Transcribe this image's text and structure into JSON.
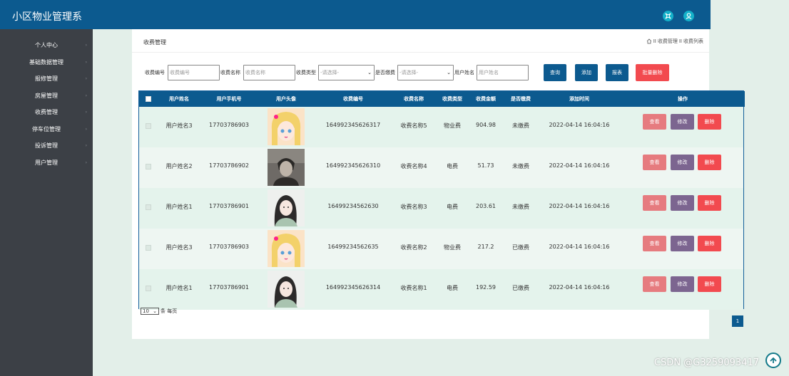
{
  "app": {
    "title": "小区物业管理系"
  },
  "header": {
    "settings_icon": "settings-icon",
    "user_icon": "user-icon"
  },
  "sidebar": {
    "items": [
      {
        "label": "个人中心"
      },
      {
        "label": "基础数据管理"
      },
      {
        "label": "报修管理"
      },
      {
        "label": "房屋管理"
      },
      {
        "label": "收费管理"
      },
      {
        "label": "停车位管理"
      },
      {
        "label": "投诉管理"
      },
      {
        "label": "用户管理"
      }
    ]
  },
  "page": {
    "title": "收费管理",
    "breadcrumb": "收费管理",
    "breadcrumb_sep": "II",
    "breadcrumb_current": "收费列表",
    "breadcrumb_home_sep": "II"
  },
  "search": {
    "fee_no_label": "收费编号",
    "fee_no_placeholder": "收费编号",
    "fee_name_label": "收费名称",
    "fee_name_placeholder": "收费名称",
    "fee_type_label": "收费类型",
    "fee_type_value": "-请选择-",
    "paid_label": "是否缴费",
    "paid_value": "-请选择-",
    "username_label": "用户姓名",
    "username_placeholder": "用户姓名"
  },
  "toolbar": {
    "query": "查询",
    "add": "添加",
    "report": "报表",
    "batch_delete": "批量删除",
    "colors": {
      "primary": "#0c5a8f",
      "danger": "#f24a4f"
    }
  },
  "table": {
    "headers": [
      "用户姓名",
      "用户手机号",
      "用户头像",
      "收费编号",
      "收费名称",
      "收费类型",
      "收费金额",
      "是否缴费",
      "添加时间",
      "操作"
    ],
    "rows": [
      {
        "username": "用户姓名3",
        "phone": "17703786903",
        "avatar": "anime-girl",
        "fee_no": "16499234562631​7",
        "fee_name": "收费名称5",
        "fee_type": "物业费",
        "amount": "904.98",
        "paid": "未缴费",
        "time": "2022-04-14 16:04:16"
      },
      {
        "username": "用户姓名2",
        "phone": "17703786902",
        "avatar": "man-portrait",
        "fee_no": "16499234562631​0",
        "fee_name": "收费名称4",
        "fee_type": "电费",
        "amount": "51.73",
        "paid": "未缴费",
        "time": "2022-04-14 16:04:16"
      },
      {
        "username": "用户姓名1",
        "phone": "17703786901",
        "avatar": "woman-portrait",
        "fee_no": "16499234562630",
        "fee_name": "收费名称3",
        "fee_type": "电费",
        "amount": "203.61",
        "paid": "未缴费",
        "time": "2022-04-14 16:04:16"
      },
      {
        "username": "用户姓名3",
        "phone": "17703786903",
        "avatar": "anime-girl",
        "fee_no": "16499234562635",
        "fee_name": "收费名称2",
        "fee_type": "物业费",
        "amount": "217.2",
        "paid": "已缴费",
        "time": "2022-04-14 16:04:16"
      },
      {
        "username": "用户姓名1",
        "phone": "17703786901",
        "avatar": "woman-portrait",
        "fee_no": "16499234562631​4",
        "fee_name": "收费名称1",
        "fee_type": "电费",
        "amount": "192.59",
        "paid": "已缴费",
        "time": "2022-04-14 16:04:16"
      }
    ],
    "actions": {
      "view": "查看",
      "edit": "修改",
      "delete": "删除"
    }
  },
  "pagination": {
    "page_size": "10",
    "page_size_suffix": "条 每页",
    "current_page": "1"
  },
  "watermark": "CSDN @G3259093417"
}
